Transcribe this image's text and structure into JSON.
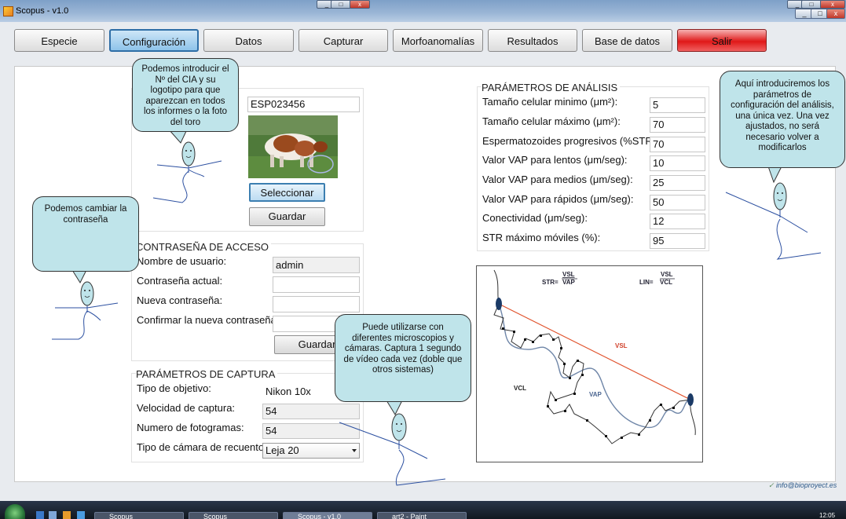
{
  "window": {
    "title": "Scopus - v1.0",
    "background_tab": "art2 - Paint"
  },
  "toolbar": [
    {
      "label": "Especie"
    },
    {
      "label": "Configuración",
      "active": true
    },
    {
      "label": "Datos"
    },
    {
      "label": "Capturar"
    },
    {
      "label": "Morfoanomalías"
    },
    {
      "label": "Resultados"
    },
    {
      "label": "Base de datos"
    },
    {
      "label": "Salir"
    }
  ],
  "clinic": {
    "cia_value": "ESP023456",
    "select_label": "Seleccionar",
    "save_label": "Guardar"
  },
  "password": {
    "header": "CONTRASEÑA DE ACCESO",
    "user_label": "Nombre de usuario:",
    "user_value": "admin",
    "current_label": "Contraseña actual:",
    "new_label": "Nueva contraseña:",
    "confirm_label": "Confirmar la nueva contraseña:",
    "save_label": "Guardar"
  },
  "capture": {
    "header": "PARÁMETROS DE CAPTURA",
    "objective_label": "Tipo de objetivo:",
    "objective_value": "Nikon 10x",
    "speed_label": "Velocidad de captura:",
    "speed_value": "54",
    "frames_label": "Numero de fotogramas:",
    "frames_value": "54",
    "camera_label": "Tipo de cámara de recuento:",
    "camera_value": "Leja 20"
  },
  "analysis": {
    "header": "PARÁMETROS DE ANÁLISIS",
    "rows": [
      {
        "label": "Tamaño celular minimo (μm²):",
        "value": "5"
      },
      {
        "label": "Tamaño celular máximo (μm²):",
        "value": "70"
      },
      {
        "label": "Espermatozoides progresivos (%STR):",
        "value": "70"
      },
      {
        "label": "Valor VAP para lentos (μm/seg):",
        "value": "10"
      },
      {
        "label": "Valor VAP para medios (μm/seg):",
        "value": "25"
      },
      {
        "label": "Valor VAP para rápidos (μm/seg):",
        "value": "50"
      },
      {
        "label": "Conectividad (μm/seg):",
        "value": "12"
      },
      {
        "label": "STR máximo móviles (%):",
        "value": "95"
      }
    ]
  },
  "diagram": {
    "str_eq": "STR=",
    "lin_eq": "LIN=",
    "vsl": "VSL",
    "vap": "VAP",
    "vcl": "VCL"
  },
  "bubbles": {
    "cia": "Podemos introducir el Nº del CIA y su logotipo para que aparezcan en todos los informes o la foto del toro",
    "password": "Podemos cambiar la contraseña",
    "analysis": "Aquí introduciremos los parámetros de configuración del análisis, una única vez. Una vez ajustados, no será necesario volver a modificarlos",
    "capture": "Puede utilizarse con diferentes microscopios y cámaras. Captura 1 segundo de vídeo cada vez (doble que otros sistemas)"
  },
  "footer": {
    "email": "info@bioproyect.es"
  },
  "taskbar": {
    "tasks": [
      "Scopus",
      "Scopus",
      "Scopus - v1.0",
      "art2 - Paint"
    ],
    "clock": "12:05"
  },
  "colors": {
    "bubble": "#bfe4ea",
    "exit_button": "#e01818",
    "active_button": "#8ec3ea",
    "vsl_line": "#e0502a"
  }
}
